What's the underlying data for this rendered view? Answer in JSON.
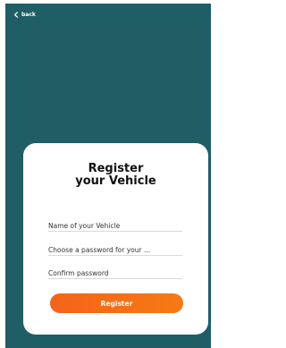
{
  "header": {
    "back_label": "back"
  },
  "form": {
    "title_line1": "Register",
    "title_line2": "your Vehicle",
    "vehicle_name_placeholder": "Name of your Vehicle",
    "password_placeholder": "Choose a password for your ...",
    "confirm_placeholder": "Confirm password",
    "register_label": "Register"
  },
  "colors": {
    "background": "#1f5e64",
    "card": "#ffffff",
    "accent": "#f5631a"
  },
  "icons": {
    "back": "chevron-left-icon"
  }
}
